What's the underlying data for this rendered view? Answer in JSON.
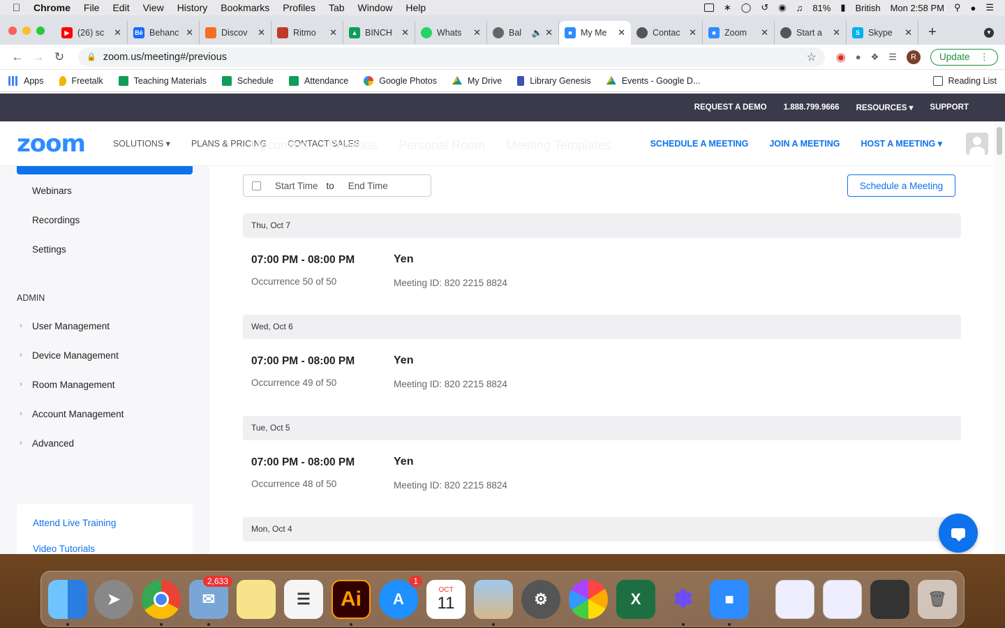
{
  "menubar": {
    "app": "Chrome",
    "items": [
      "File",
      "Edit",
      "View",
      "History",
      "Bookmarks",
      "Profiles",
      "Tab",
      "Window",
      "Help"
    ],
    "battery": "81%",
    "input_source": "British",
    "clock": "Mon 2:58 PM"
  },
  "tabs": [
    {
      "title": "(26) sc",
      "icon": "youtube-icon",
      "color": "#ff0000"
    },
    {
      "title": "Behanc",
      "icon": "behance-icon",
      "color": "#1769ff"
    },
    {
      "title": "Discov",
      "icon": "soundcloud-icon",
      "color": "#f26f23"
    },
    {
      "title": "Ritmo",
      "icon": "ritmo-icon",
      "color": "#c0392b"
    },
    {
      "title": "BINCH",
      "icon": "google-drive-icon",
      "color": "#0f9d58"
    },
    {
      "title": "Whats",
      "icon": "whatsapp-icon",
      "color": "#25d366"
    },
    {
      "title": "Bal",
      "icon": "globe-icon",
      "color": "#666666"
    },
    {
      "title": "My Me",
      "icon": "zoom-icon",
      "color": "#2d8cff"
    },
    {
      "title": "Contac",
      "icon": "globe-icon",
      "color": "#555555"
    },
    {
      "title": "Zoom",
      "icon": "zoom-icon",
      "color": "#2d8cff"
    },
    {
      "title": "Start a",
      "icon": "globe-icon",
      "color": "#555555"
    },
    {
      "title": "Skype",
      "icon": "skype-icon",
      "color": "#00aff0"
    }
  ],
  "toolbar": {
    "url": "zoom.us/meeting#/previous",
    "profile_initial": "R",
    "update_label": "Update"
  },
  "bookmarks": [
    {
      "label": "Apps",
      "color": "#4285f4"
    },
    {
      "label": "Freetalk",
      "color": "#f4b400"
    },
    {
      "label": "Teaching Materials",
      "color": "#0f9d58"
    },
    {
      "label": "Schedule",
      "color": "#0f9d58"
    },
    {
      "label": "Attendance",
      "color": "#0f9d58"
    },
    {
      "label": "Google Photos",
      "color": "#ea4335"
    },
    {
      "label": "My Drive",
      "color": "#4285f4"
    },
    {
      "label": "Library Genesis",
      "color": "#3f51b5"
    },
    {
      "label": "Events - Google D...",
      "color": "#f4b400"
    }
  ],
  "reading_list": "Reading List",
  "zoom": {
    "topbar": [
      "REQUEST A DEMO",
      "1.888.799.9666",
      "RESOURCES",
      "SUPPORT"
    ],
    "logo": "zoom",
    "nav_left": [
      "SOLUTIONS",
      "PLANS & PRICING",
      "CONTACT SALES"
    ],
    "nav_right": [
      "SCHEDULE A MEETING",
      "JOIN A MEETING",
      "HOST A MEETING"
    ],
    "sidebar_items": [
      "Webinars",
      "Recordings",
      "Settings"
    ],
    "admin_label": "ADMIN",
    "admin_items": [
      "User Management",
      "Device Management",
      "Room Management",
      "Account Management",
      "Advanced"
    ],
    "help_links": [
      "Attend Live Training",
      "Video Tutorials"
    ],
    "date_start_placeholder": "Start Time",
    "date_to": "to",
    "date_end_placeholder": "End Time",
    "schedule_button": "Schedule a Meeting",
    "days": [
      {
        "date": "Thu, Oct 7",
        "time": "07:00 PM - 08:00 PM",
        "occurrence": "Occurrence 50 of 50",
        "topic": "Yen",
        "meeting_id": "Meeting ID: 820 2215 8824"
      },
      {
        "date": "Wed, Oct 6",
        "time": "07:00 PM - 08:00 PM",
        "occurrence": "Occurrence 49 of 50",
        "topic": "Yen",
        "meeting_id": "Meeting ID: 820 2215 8824"
      },
      {
        "date": "Tue, Oct 5",
        "time": "07:00 PM - 08:00 PM",
        "occurrence": "Occurrence 48 of 50",
        "topic": "Yen",
        "meeting_id": "Meeting ID: 820 2215 8824"
      },
      {
        "date": "Mon, Oct 4"
      }
    ]
  },
  "dock": {
    "mail_badge": "2,633",
    "appstore_badge": "1",
    "calendar_month": "OCT",
    "calendar_day": "11",
    "illustrator_label": "Ai"
  }
}
